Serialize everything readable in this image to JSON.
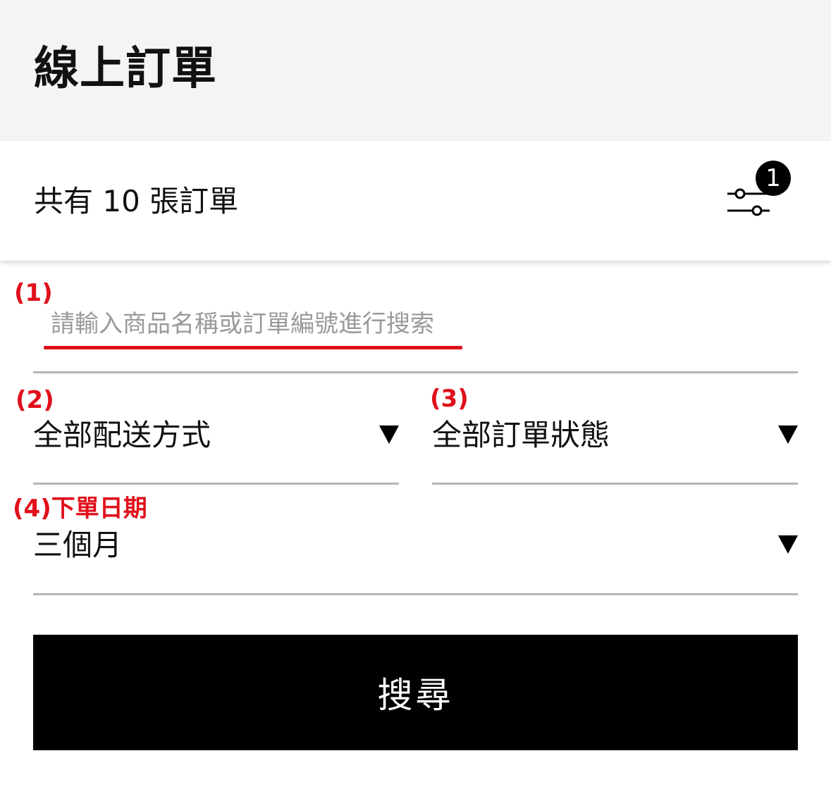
{
  "header": {
    "title": "線上訂單"
  },
  "summary": {
    "order_count_text": "共有 10 張訂單",
    "filter_badge_count": "1",
    "filter_icon": "sliders-icon"
  },
  "annotations": {
    "a1": "(1)",
    "a2": "(2)",
    "a3": "(3)",
    "a4": "(4)下單日期"
  },
  "search": {
    "value": "",
    "placeholder": "請輸入商品名稱或訂單編號進行搜索"
  },
  "filters": {
    "delivery": {
      "selected": "全部配送方式",
      "icon": "caret-down-icon"
    },
    "status": {
      "selected": "全部訂單狀態",
      "icon": "caret-down-icon"
    },
    "date_range": {
      "selected": "三個月",
      "icon": "caret-down-icon"
    }
  },
  "search_button": {
    "label": "搜尋"
  },
  "colors": {
    "header_bg": "#f4f4f4",
    "accent_red": "#e0101b",
    "button_bg": "#000000",
    "divider": "#b5b5b5"
  }
}
